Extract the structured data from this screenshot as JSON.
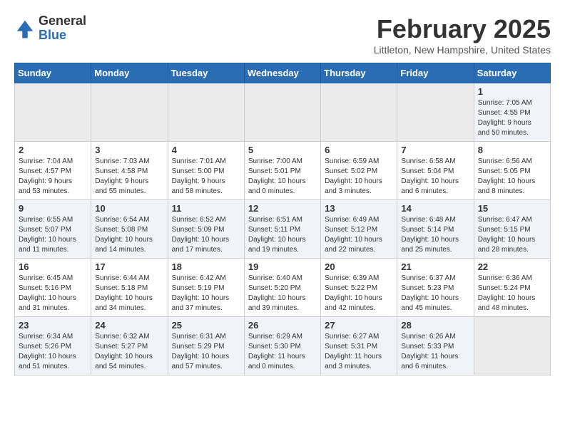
{
  "logo": {
    "general": "General",
    "blue": "Blue"
  },
  "header": {
    "month": "February 2025",
    "location": "Littleton, New Hampshire, United States"
  },
  "weekdays": [
    "Sunday",
    "Monday",
    "Tuesday",
    "Wednesday",
    "Thursday",
    "Friday",
    "Saturday"
  ],
  "weeks": [
    [
      {
        "day": "",
        "info": ""
      },
      {
        "day": "",
        "info": ""
      },
      {
        "day": "",
        "info": ""
      },
      {
        "day": "",
        "info": ""
      },
      {
        "day": "",
        "info": ""
      },
      {
        "day": "",
        "info": ""
      },
      {
        "day": "1",
        "info": "Sunrise: 7:05 AM\nSunset: 4:55 PM\nDaylight: 9 hours\nand 50 minutes."
      }
    ],
    [
      {
        "day": "2",
        "info": "Sunrise: 7:04 AM\nSunset: 4:57 PM\nDaylight: 9 hours\nand 53 minutes."
      },
      {
        "day": "3",
        "info": "Sunrise: 7:03 AM\nSunset: 4:58 PM\nDaylight: 9 hours\nand 55 minutes."
      },
      {
        "day": "4",
        "info": "Sunrise: 7:01 AM\nSunset: 5:00 PM\nDaylight: 9 hours\nand 58 minutes."
      },
      {
        "day": "5",
        "info": "Sunrise: 7:00 AM\nSunset: 5:01 PM\nDaylight: 10 hours\nand 0 minutes."
      },
      {
        "day": "6",
        "info": "Sunrise: 6:59 AM\nSunset: 5:02 PM\nDaylight: 10 hours\nand 3 minutes."
      },
      {
        "day": "7",
        "info": "Sunrise: 6:58 AM\nSunset: 5:04 PM\nDaylight: 10 hours\nand 6 minutes."
      },
      {
        "day": "8",
        "info": "Sunrise: 6:56 AM\nSunset: 5:05 PM\nDaylight: 10 hours\nand 8 minutes."
      }
    ],
    [
      {
        "day": "9",
        "info": "Sunrise: 6:55 AM\nSunset: 5:07 PM\nDaylight: 10 hours\nand 11 minutes."
      },
      {
        "day": "10",
        "info": "Sunrise: 6:54 AM\nSunset: 5:08 PM\nDaylight: 10 hours\nand 14 minutes."
      },
      {
        "day": "11",
        "info": "Sunrise: 6:52 AM\nSunset: 5:09 PM\nDaylight: 10 hours\nand 17 minutes."
      },
      {
        "day": "12",
        "info": "Sunrise: 6:51 AM\nSunset: 5:11 PM\nDaylight: 10 hours\nand 19 minutes."
      },
      {
        "day": "13",
        "info": "Sunrise: 6:49 AM\nSunset: 5:12 PM\nDaylight: 10 hours\nand 22 minutes."
      },
      {
        "day": "14",
        "info": "Sunrise: 6:48 AM\nSunset: 5:14 PM\nDaylight: 10 hours\nand 25 minutes."
      },
      {
        "day": "15",
        "info": "Sunrise: 6:47 AM\nSunset: 5:15 PM\nDaylight: 10 hours\nand 28 minutes."
      }
    ],
    [
      {
        "day": "16",
        "info": "Sunrise: 6:45 AM\nSunset: 5:16 PM\nDaylight: 10 hours\nand 31 minutes."
      },
      {
        "day": "17",
        "info": "Sunrise: 6:44 AM\nSunset: 5:18 PM\nDaylight: 10 hours\nand 34 minutes."
      },
      {
        "day": "18",
        "info": "Sunrise: 6:42 AM\nSunset: 5:19 PM\nDaylight: 10 hours\nand 37 minutes."
      },
      {
        "day": "19",
        "info": "Sunrise: 6:40 AM\nSunset: 5:20 PM\nDaylight: 10 hours\nand 39 minutes."
      },
      {
        "day": "20",
        "info": "Sunrise: 6:39 AM\nSunset: 5:22 PM\nDaylight: 10 hours\nand 42 minutes."
      },
      {
        "day": "21",
        "info": "Sunrise: 6:37 AM\nSunset: 5:23 PM\nDaylight: 10 hours\nand 45 minutes."
      },
      {
        "day": "22",
        "info": "Sunrise: 6:36 AM\nSunset: 5:24 PM\nDaylight: 10 hours\nand 48 minutes."
      }
    ],
    [
      {
        "day": "23",
        "info": "Sunrise: 6:34 AM\nSunset: 5:26 PM\nDaylight: 10 hours\nand 51 minutes."
      },
      {
        "day": "24",
        "info": "Sunrise: 6:32 AM\nSunset: 5:27 PM\nDaylight: 10 hours\nand 54 minutes."
      },
      {
        "day": "25",
        "info": "Sunrise: 6:31 AM\nSunset: 5:29 PM\nDaylight: 10 hours\nand 57 minutes."
      },
      {
        "day": "26",
        "info": "Sunrise: 6:29 AM\nSunset: 5:30 PM\nDaylight: 11 hours\nand 0 minutes."
      },
      {
        "day": "27",
        "info": "Sunrise: 6:27 AM\nSunset: 5:31 PM\nDaylight: 11 hours\nand 3 minutes."
      },
      {
        "day": "28",
        "info": "Sunrise: 6:26 AM\nSunset: 5:33 PM\nDaylight: 11 hours\nand 6 minutes."
      },
      {
        "day": "",
        "info": ""
      }
    ]
  ]
}
